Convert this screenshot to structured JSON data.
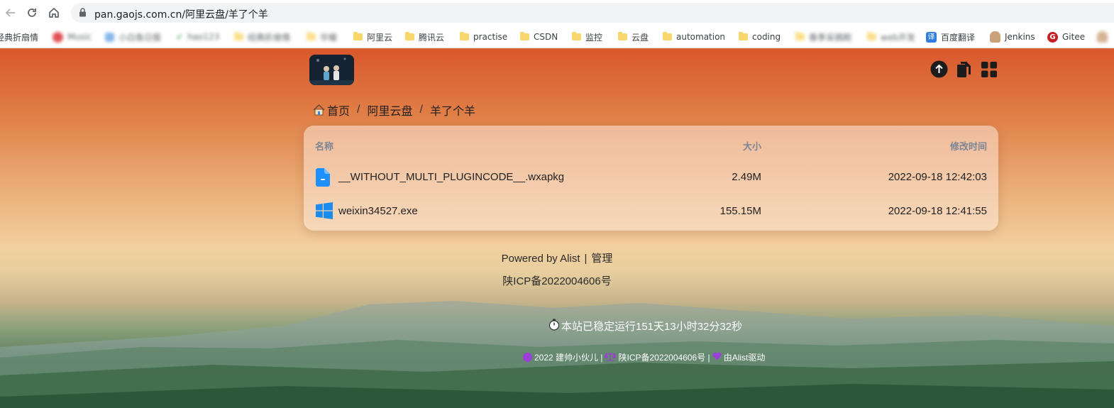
{
  "browser": {
    "url": "pan.gaojs.com.cn/阿里云盘/羊了个羊",
    "bookmarks": [
      {
        "label": "经典折扇情",
        "icon": "page-icon",
        "blurred": false
      },
      {
        "label": "Music",
        "icon": "music-icon",
        "blurred": true
      },
      {
        "label": "小白鱼日报",
        "icon": "page-icon",
        "blurred": true
      },
      {
        "label": "hao123",
        "icon": "check-icon",
        "blurred": true
      },
      {
        "label": "经典折扇情",
        "icon": "folder-icon",
        "blurred": true
      },
      {
        "label": "华耀",
        "icon": "folder-icon",
        "blurred": true
      },
      {
        "label": "阿里云",
        "icon": "folder-icon",
        "blurred": false
      },
      {
        "label": "腾讯云",
        "icon": "folder-icon",
        "blurred": false
      },
      {
        "label": "practise",
        "icon": "folder-icon",
        "blurred": false
      },
      {
        "label": "CSDN",
        "icon": "folder-icon",
        "blurred": false
      },
      {
        "label": "监控",
        "icon": "folder-icon",
        "blurred": false
      },
      {
        "label": "云盘",
        "icon": "folder-icon",
        "blurred": false
      },
      {
        "label": "automation",
        "icon": "folder-icon",
        "blurred": false
      },
      {
        "label": "coding",
        "icon": "folder-icon",
        "blurred": false
      },
      {
        "label": "春季采摘刷",
        "icon": "folder-icon",
        "blurred": true
      },
      {
        "label": "web开发",
        "icon": "folder-icon",
        "blurred": true
      },
      {
        "label": "百度翻译",
        "icon": "translate-icon",
        "blurred": false
      },
      {
        "label": "Jenkins",
        "icon": "jenkins-icon",
        "blurred": false
      },
      {
        "label": "Gitee",
        "icon": "gitee-icon",
        "blurred": false
      }
    ]
  },
  "breadcrumb": {
    "home": "首页",
    "items": [
      "阿里云盘",
      "羊了个羊"
    ]
  },
  "table": {
    "headers": {
      "name": "名称",
      "size": "大小",
      "modified": "修改时间"
    },
    "rows": [
      {
        "name": "__WITHOUT_MULTI_PLUGINCODE__.wxapkg",
        "size": "2.49M",
        "modified": "2022-09-18 12:42:03",
        "icon": "file-icon"
      },
      {
        "name": "weixin34527.exe",
        "size": "155.15M",
        "modified": "2022-09-18 12:41:55",
        "icon": "windows-icon"
      }
    ]
  },
  "footer": {
    "powered": "Powered by Alist",
    "admin": "管理",
    "icp": "陕ICP备2022004606号",
    "uptime": "本站已稳定运行151天13小时32分32秒",
    "credit_year": "2022 建帅小伙儿 |",
    "credit_icp": "陕ICP备2022004606号 |",
    "credit_driver": "由Alist驱动"
  },
  "colors": {
    "accent": "#1e90ff",
    "windows": "#1a8cf0",
    "credit_icons": "#9b3fd6"
  }
}
